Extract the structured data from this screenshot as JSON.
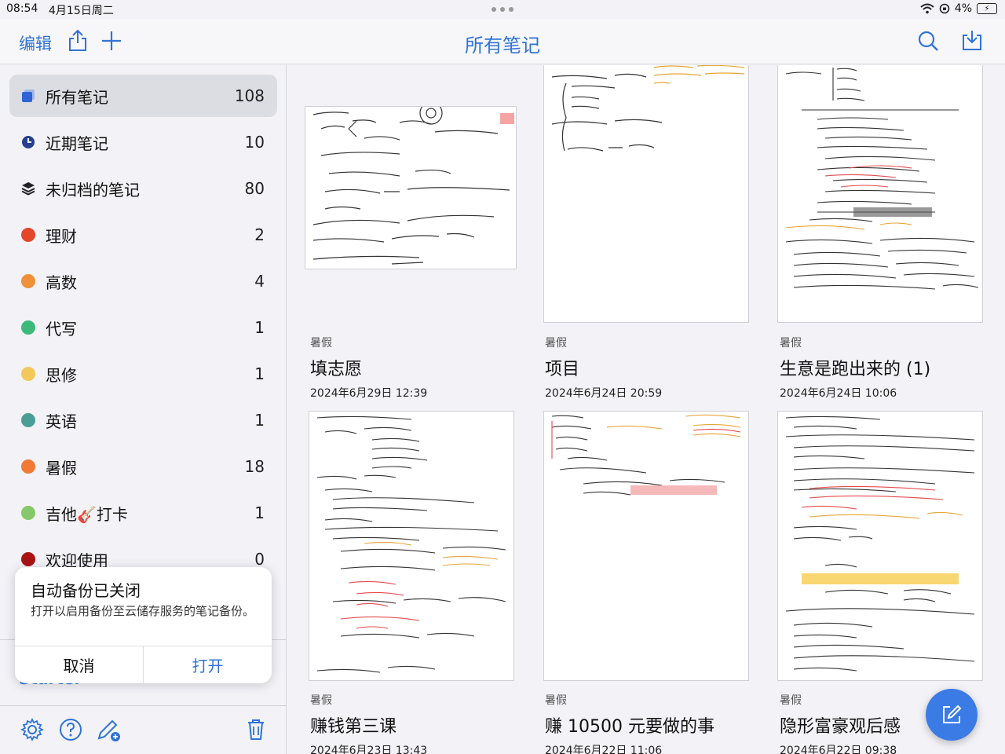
{
  "status": {
    "time": "08:54",
    "date": "4月15日周二",
    "battery": "4%"
  },
  "nav": {
    "edit": "编辑",
    "title": "所有笔记"
  },
  "sidebar": {
    "items": [
      {
        "label": "所有笔记",
        "count": "108",
        "icon": "notes-icon"
      },
      {
        "label": "近期笔记",
        "count": "10",
        "icon": "clock-icon"
      },
      {
        "label": "未归档的笔记",
        "count": "80",
        "icon": "layers-icon"
      },
      {
        "label": "理财",
        "count": "2",
        "color": "#e4462b"
      },
      {
        "label": "高数",
        "count": "4",
        "color": "#f0913a"
      },
      {
        "label": "代写",
        "count": "1",
        "color": "#3cba7a"
      },
      {
        "label": "思修",
        "count": "1",
        "color": "#f3c85a"
      },
      {
        "label": "英语",
        "count": "1",
        "color": "#4b9e95"
      },
      {
        "label": "暑假",
        "count": "18",
        "color": "#f07a36"
      },
      {
        "label": "吉他🎸打卡",
        "count": "1",
        "color": "#86c86a"
      },
      {
        "label": "欢迎使用",
        "count": "0",
        "color": "#a81414"
      }
    ],
    "starter": "Starter"
  },
  "popup": {
    "title": "自动备份已关闭",
    "message": "打开以启用备份至云储存服务的笔记备份。",
    "cancel": "取消",
    "open": "打开"
  },
  "notes": [
    {
      "folder": "暑假",
      "title": "填志愿",
      "date": "2024年6月29日 12:39"
    },
    {
      "folder": "暑假",
      "title": "项目",
      "date": "2024年6月24日 20:59"
    },
    {
      "folder": "暑假",
      "title": "生意是跑出来的 (1)",
      "date": "2024年6月24日 10:06"
    },
    {
      "folder": "暑假",
      "title": "赚钱第三课",
      "date": "2024年6月23日 13:43"
    },
    {
      "folder": "暑假",
      "title": "赚 10500 元要做的事",
      "date": "2024年6月22日 11:06"
    },
    {
      "folder": "暑假",
      "title": "隐形富豪观后感",
      "date": "2024年6月22日 09:38"
    }
  ],
  "colors": {
    "accent": "#2f73d8",
    "fab": "#3a7be6"
  }
}
